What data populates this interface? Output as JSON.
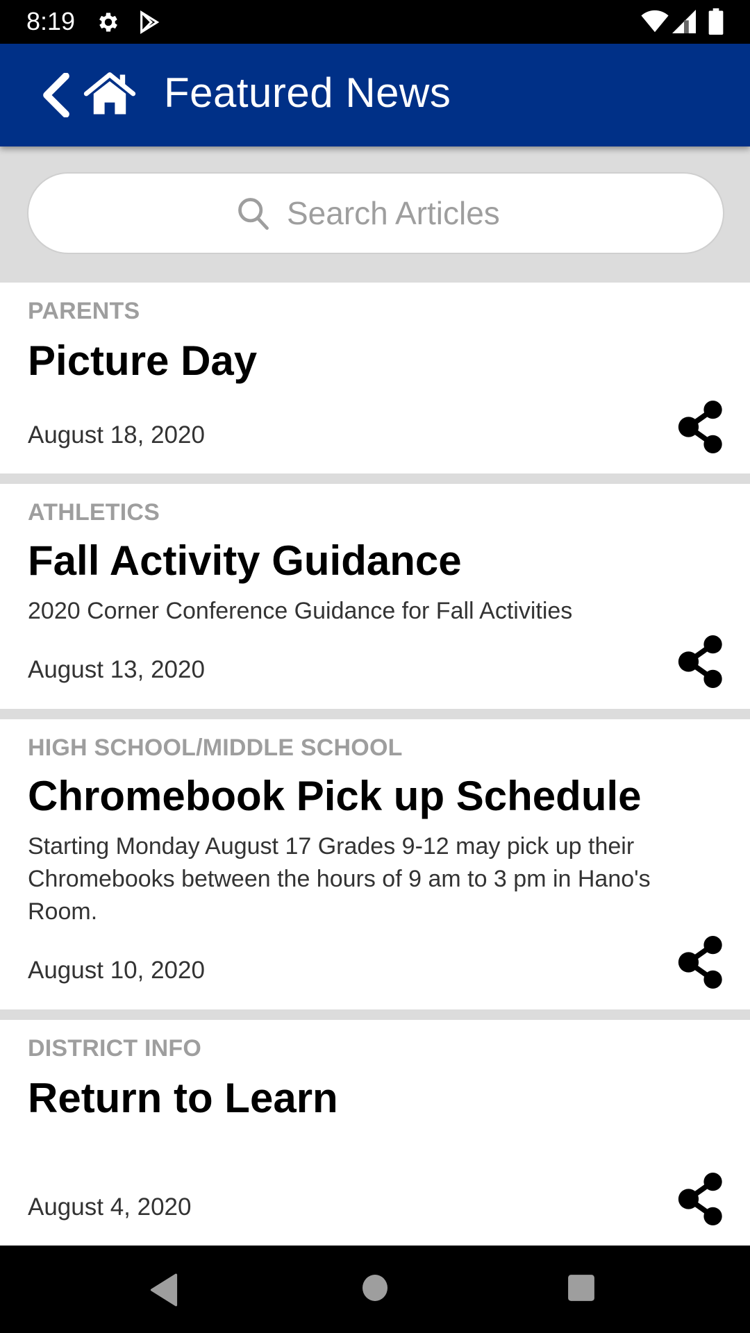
{
  "status_bar": {
    "time": "8:19",
    "left_icons": [
      "gear-icon",
      "play-store-icon"
    ],
    "right_icons": [
      "wifi-icon",
      "signal-icon",
      "battery-icon"
    ]
  },
  "app_bar": {
    "back_icon": "chevron-left-icon",
    "home_icon": "home-icon",
    "title": "Featured News",
    "background_color": "#003087"
  },
  "search": {
    "icon": "search-icon",
    "placeholder": "Search Articles",
    "value": ""
  },
  "articles": [
    {
      "category": "PARENTS",
      "title": "Picture Day",
      "summary": "",
      "date": "August 18, 2020"
    },
    {
      "category": "ATHLETICS",
      "title": "Fall Activity Guidance",
      "summary": "2020 Corner Conference Guidance for Fall Activities",
      "date": "August 13, 2020"
    },
    {
      "category": "HIGH SCHOOL/MIDDLE SCHOOL",
      "title": "Chromebook Pick up Schedule",
      "summary": "Starting Monday August 17 Grades 9-12 may  pick up their Chromebooks between the hours of 9 am to 3 pm  in Hano's Room.",
      "date": "August 10, 2020"
    },
    {
      "category": "DISTRICT INFO",
      "title": "Return to Learn",
      "summary": "",
      "date": "August 4, 2020"
    }
  ],
  "nav_bar": {
    "buttons": [
      "back-triangle-icon",
      "home-circle-icon",
      "recents-square-icon"
    ]
  }
}
